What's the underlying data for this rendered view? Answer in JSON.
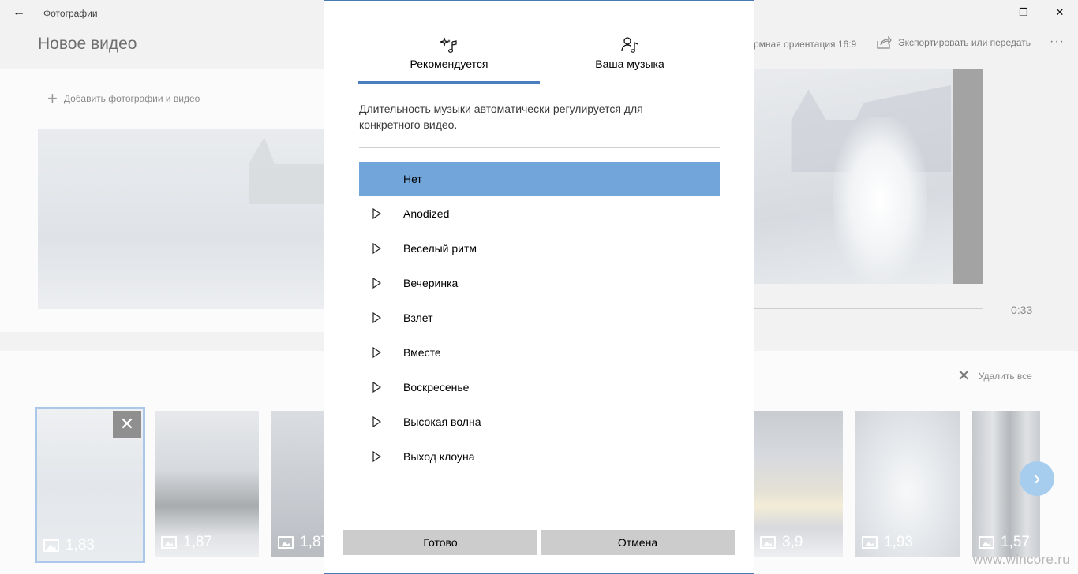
{
  "window": {
    "app_name": "Фотографии",
    "back_glyph": "←",
    "minimize_glyph": "—",
    "maximize_glyph": "❐",
    "close_glyph": "✕"
  },
  "header": {
    "title": "Новое видео",
    "aspect_label": "рмная ориентация 16:9",
    "export_label": "Экспортировать или передать",
    "more_glyph": "···"
  },
  "library": {
    "add_label": "Добавить фотографии и видео",
    "add_glyph": "+"
  },
  "preview": {
    "duration": "0:33"
  },
  "storyboard": {
    "delete_all_label": "Удалить все",
    "delete_glyph": "✕",
    "remove_glyph": "✕",
    "next_glyph": "›",
    "clips": [
      {
        "duration": "1,83"
      },
      {
        "duration": "1,87"
      },
      {
        "duration": "1,87"
      },
      {
        "duration": "3,9"
      },
      {
        "duration": "1,93"
      },
      {
        "duration": "1,57"
      }
    ]
  },
  "dialog": {
    "tabs": [
      {
        "label": "Рекомендуется",
        "icon": "sparkle-music-icon",
        "active": true
      },
      {
        "label": "Ваша музыка",
        "icon": "person-music-icon",
        "active": false
      }
    ],
    "description": "Длительность музыки автоматически регулируется для конкретного видео.",
    "tracks": [
      {
        "name": "Нет",
        "selected": true
      },
      {
        "name": "Anodized"
      },
      {
        "name": "Веселый ритм"
      },
      {
        "name": "Вечеринка"
      },
      {
        "name": "Взлет"
      },
      {
        "name": "Вместе"
      },
      {
        "name": "Воскресенье"
      },
      {
        "name": "Высокая волна"
      },
      {
        "name": "Выход клоуна"
      }
    ],
    "done_label": "Готово",
    "cancel_label": "Отмена"
  },
  "watermark": "www.wincore.ru",
  "colors": {
    "accent": "#4a7fbf",
    "selected_row": "#72a6db",
    "button": "#cccccc",
    "next_button": "#a7cdee"
  }
}
